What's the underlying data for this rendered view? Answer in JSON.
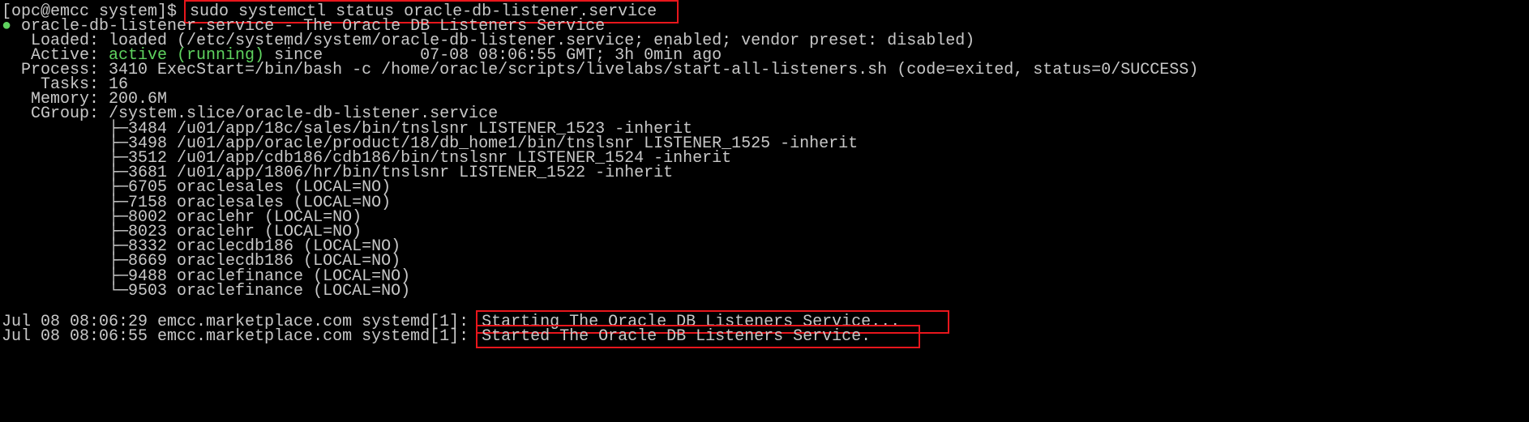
{
  "prompt": "[opc@emcc system]$ ",
  "command": "sudo systemctl status oracle-db-listener.service",
  "status_dot": "●",
  "service_name": " oracle-db-listener.service - The Oracle DB Listeners Service",
  "loaded": {
    "label": "   Loaded: ",
    "value": "loaded (/etc/systemd/system/oracle-db-listener.service; enabled; vendor preset: disabled)"
  },
  "active": {
    "label": "   Active: ",
    "state": "active (running)",
    "since": " since          07-08 08:06:55 GMT; 3h 0min ago"
  },
  "process": {
    "label": "  Process: ",
    "value": "3410 ExecStart=/bin/bash -c /home/oracle/scripts/livelabs/start-all-listeners.sh (code=exited, status=0/SUCCESS)"
  },
  "tasks": {
    "label": "    Tasks: ",
    "value": "16"
  },
  "memory": {
    "label": "   Memory: ",
    "value": "200.6M"
  },
  "cgroup": {
    "label": "   CGroup: ",
    "value": "/system.slice/oracle-db-listener.service"
  },
  "cgroup_tree": [
    "           ├─3484 /u01/app/18c/sales/bin/tnslsnr LISTENER_1523 -inherit",
    "           ├─3498 /u01/app/oracle/product/18/db_home1/bin/tnslsnr LISTENER_1525 -inherit",
    "           ├─3512 /u01/app/cdb186/cdb186/bin/tnslsnr LISTENER_1524 -inherit",
    "           ├─3681 /u01/app/1806/hr/bin/tnslsnr LISTENER_1522 -inherit",
    "           ├─6705 oraclesales (LOCAL=NO)",
    "           ├─7158 oraclesales (LOCAL=NO)",
    "           ├─8002 oraclehr (LOCAL=NO)",
    "           ├─8023 oraclehr (LOCAL=NO)",
    "           ├─8332 oraclecdb186 (LOCAL=NO)",
    "           ├─8669 oraclecdb186 (LOCAL=NO)",
    "           ├─9488 oraclefinance (LOCAL=NO)",
    "           └─9503 oraclefinance (LOCAL=NO)"
  ],
  "logs": [
    {
      "prefix": "Jul 08 08:06:29 emcc.marketplace.com systemd[1]: ",
      "message": "Starting The Oracle DB Listeners Service..."
    },
    {
      "prefix": "Jul 08 08:06:55 emcc.marketplace.com systemd[1]: ",
      "message": "Started The Oracle DB Listeners Service."
    }
  ],
  "colors": {
    "background": "#000000",
    "text": "#c8c8c8",
    "active_green": "#5fd35f",
    "highlight_box": "#e8161c"
  }
}
